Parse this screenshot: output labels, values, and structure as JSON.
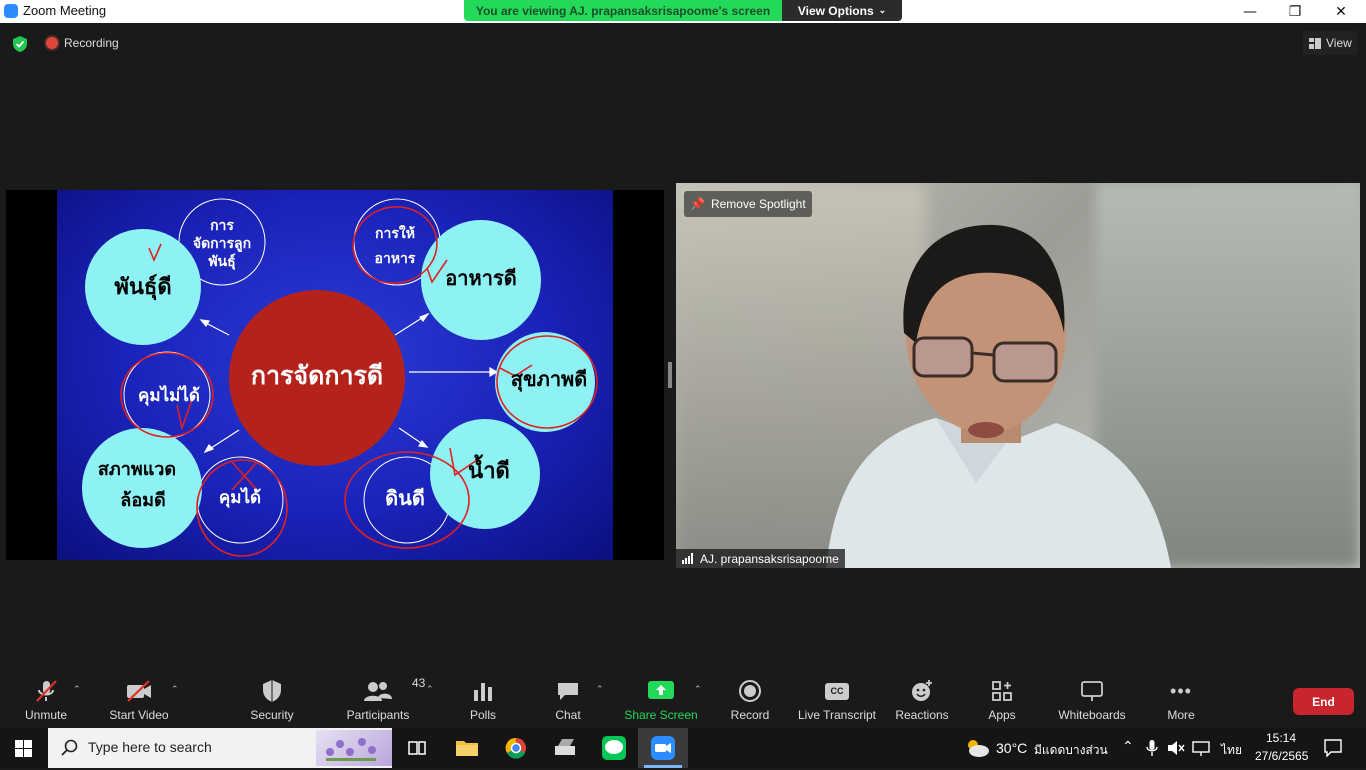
{
  "window": {
    "title": "Zoom Meeting",
    "banner": "You are viewing AJ. prapansaksrisapoome's screen",
    "view_options": "View Options"
  },
  "meeting": {
    "recording": "Recording",
    "view": "View"
  },
  "slide": {
    "center": "การจัดการดี",
    "top_left": "พันธุ์ดี",
    "top_small": [
      "การ",
      "จัดการลูก",
      "พันธุ์"
    ],
    "top_right_small": [
      "การให้",
      "อาหาร"
    ],
    "top_right": "อาหารดี",
    "right": "สุขภาพดี",
    "left_small": "คุมไม่ได้",
    "bottom_left": [
      "สภาพแวด",
      "ล้อมดี"
    ],
    "bottom_small": "คุมได้",
    "bottom_right": "น้ำดี",
    "bottom_soil": "ดินดี"
  },
  "video": {
    "remove_spotlight": "Remove Spotlight",
    "participant_name": "AJ. prapansaksrisapoome"
  },
  "toolbar": {
    "unmute": "Unmute",
    "start_video": "Start Video",
    "security": "Security",
    "participants": "Participants",
    "participants_count": "43",
    "polls": "Polls",
    "chat": "Chat",
    "share_screen": "Share Screen",
    "record": "Record",
    "live_transcript": "Live Transcript",
    "reactions": "Reactions",
    "apps": "Apps",
    "whiteboards": "Whiteboards",
    "more": "More",
    "end": "End",
    "cc": "CC",
    "share_color": "#23d959",
    "end_color": "#c9252d"
  },
  "taskbar": {
    "search_placeholder": "Type here to search",
    "weather_temp": "30°C",
    "weather_desc": "มีแดดบางส่วน",
    "language": "ไทย",
    "time": "15:14",
    "date": "27/6/2565"
  }
}
